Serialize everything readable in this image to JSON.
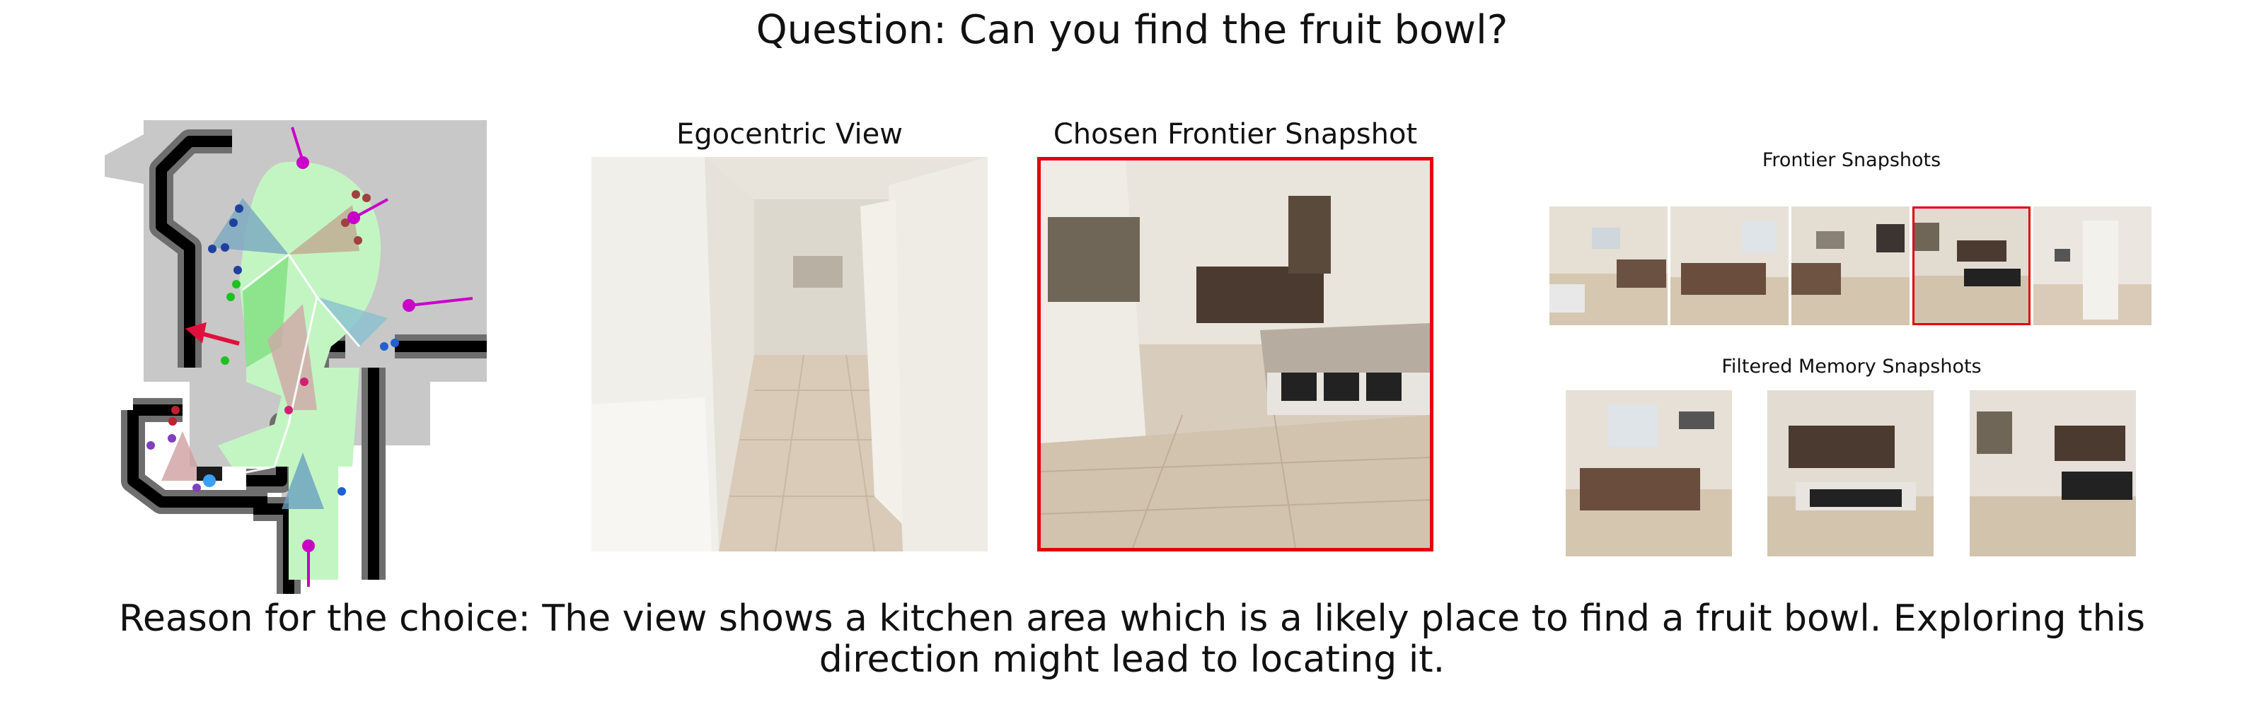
{
  "question": "Question: Can you find the fruit bowl?",
  "panels": {
    "egocentric_title": "Egocentric View",
    "chosen_title": "Chosen Frontier Snapshot",
    "frontier_title": "Frontier Snapshots",
    "memory_title": "Filtered Memory Snapshots"
  },
  "frontier_snapshots": {
    "count": 5,
    "selected_index": 3
  },
  "memory_snapshots": {
    "count": 3
  },
  "reason": "Reason for the choice: The view shows a kitchen area which is a likely place to find a fruit bowl. Exploring this direction might lead to locating it.",
  "colors": {
    "selection_border": "#e0000f",
    "explored_area": "#c3f5c3",
    "wall": "#000000",
    "unexplored": "#c8c8c8",
    "frontier_arrow": "#c800c8"
  },
  "icons": {
    "map": "top-down-navigation-map"
  }
}
